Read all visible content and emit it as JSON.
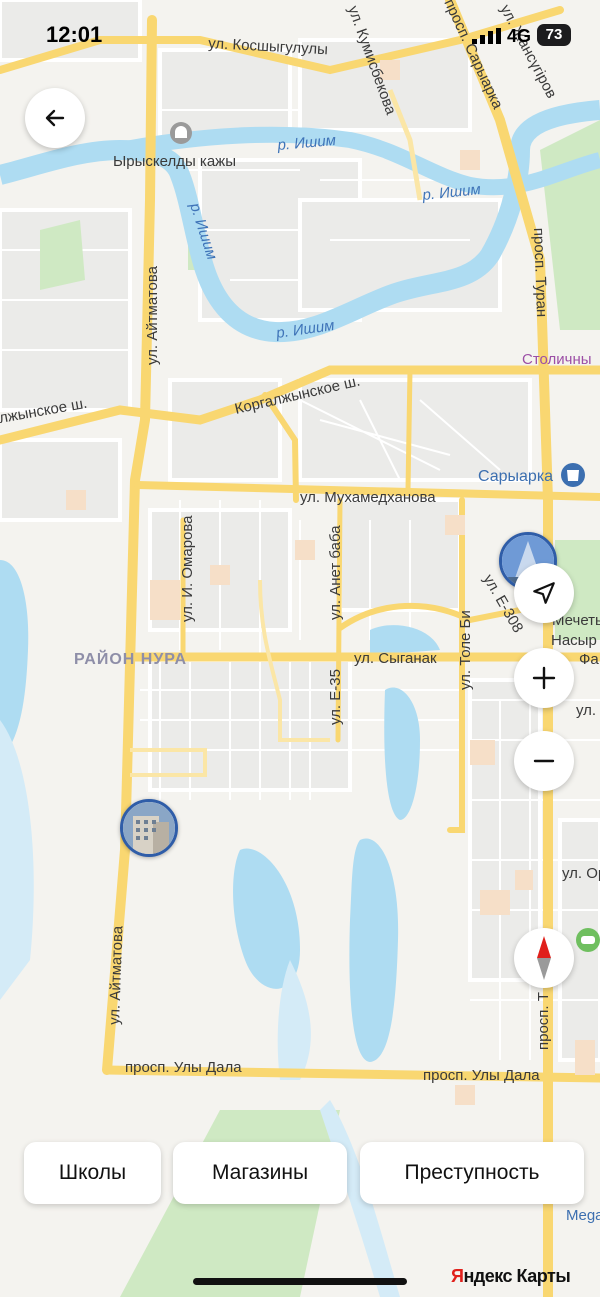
{
  "status_bar": {
    "time": "12:01",
    "network": "4G",
    "battery": "73"
  },
  "map": {
    "streets": [
      "ул. Косшыгулулы",
      "ул. Кумисбекова",
      "просп. Сарыарка",
      "ул. Жансүгіров",
      "ул. Айтматова",
      "ул. Айтматова",
      "Коргалжынское ш.",
      "лжынское ш.",
      "ул. Мухамедханова",
      "ул. И. Омарова",
      "ул. Анет баба",
      "ул. Е-35",
      "ул. Сыганак",
      "ул. Толе Би",
      "ул. Е-308",
      "просп. Туран",
      "просп. Улы Дала",
      "просп. Улы Дала",
      "ул. Петр",
      "ул. Ор",
      "просп. Т"
    ],
    "rivers": [
      "р. Ишим",
      "р. Ишим",
      "р. Ишим",
      "р. Ишим"
    ],
    "district": "РАЙОН НУРА",
    "places": {
      "mosque": "Ырыскелды кажы",
      "sary_arka": "Сарыарка",
      "stolichny": "Столичны",
      "mosque2_line1": "Мечеть",
      "mosque2_line2": "Насыр",
      "fa": "Фа",
      "mega": "Mega"
    }
  },
  "controls": {
    "back_icon": "arrow-left-icon",
    "locate_icon": "navigation-arrow-icon",
    "zoom_in_icon": "plus-icon",
    "zoom_out_icon": "minus-icon",
    "compass_icon": "compass-icon"
  },
  "chips": [
    "Школы",
    "Магазины",
    "Преступность"
  ],
  "brand": {
    "part1": "Я",
    "part2": "ндекс Карты"
  },
  "colors": {
    "water": "#aedcf2",
    "road_major": "#f9d771",
    "brand_red": "#e0201b",
    "poi_blue": "#3c6fb0"
  }
}
